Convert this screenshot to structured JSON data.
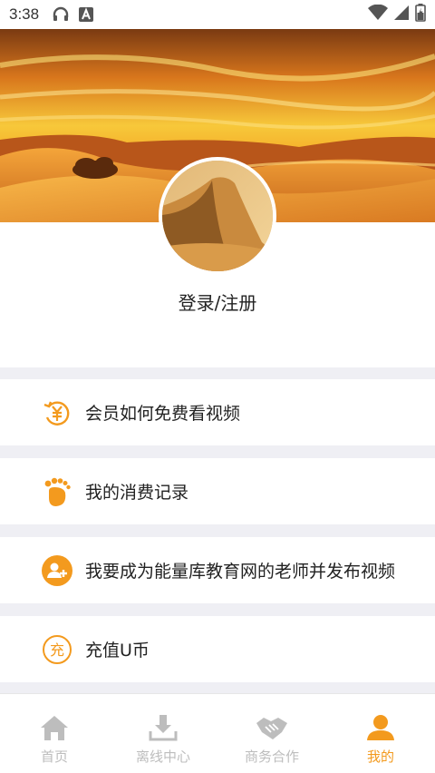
{
  "status_bar": {
    "time": "3:38",
    "icons": [
      "headphones-icon",
      "keyboard-a-icon",
      "wifi-icon",
      "signal-icon",
      "battery-icon"
    ]
  },
  "profile": {
    "login_label": "登录/注册"
  },
  "menu": {
    "items": [
      {
        "label": "会员如何免费看视频",
        "icon": "yen-refresh-icon"
      },
      {
        "label": "我的消费记录",
        "icon": "footprint-icon"
      },
      {
        "label": "我要成为能量库教育网的老师并发布视频",
        "icon": "add-user-icon"
      },
      {
        "label": "充值U币",
        "icon": "recharge-icon",
        "icon_text": "充"
      }
    ]
  },
  "tabbar": {
    "tabs": [
      {
        "label": "首页",
        "icon": "home-icon",
        "active": false
      },
      {
        "label": "离线中心",
        "icon": "download-icon",
        "active": false
      },
      {
        "label": "商务合作",
        "icon": "handshake-icon",
        "active": false
      },
      {
        "label": "我的",
        "icon": "person-icon",
        "active": true
      }
    ]
  },
  "colors": {
    "accent": "#f39a1e",
    "inactive": "#bdbdbd",
    "background": "#efeff4"
  }
}
